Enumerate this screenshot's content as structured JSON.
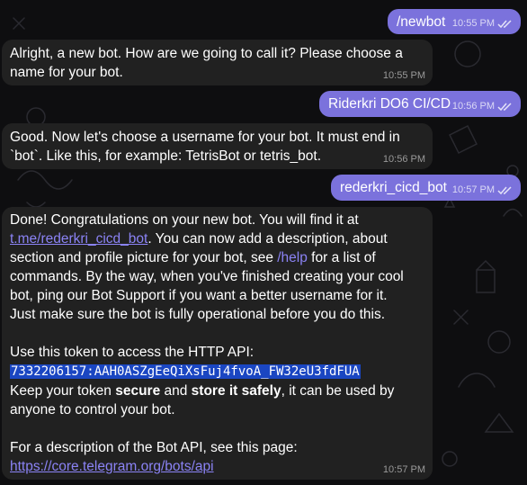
{
  "colors": {
    "outgoing": "#7b72dc",
    "incoming": "#212121",
    "link": "#8b83f5",
    "token_highlight": "#1a46c2",
    "background": "#0e0e10"
  },
  "messages": [
    {
      "direction": "out",
      "text": "/newbot",
      "time": "10:55 PM",
      "status": "read"
    },
    {
      "direction": "in",
      "lines": [
        "Alright, a new bot. How are we going to call it? Please choose a",
        "name for your bot."
      ],
      "time": "10:55 PM"
    },
    {
      "direction": "out",
      "text": "Riderkri DO6 CI/CD",
      "time": "10:56 PM",
      "status": "read"
    },
    {
      "direction": "in",
      "lines": [
        "Good. Now let's choose a username for your bot. It must end in",
        "`bot`. Like this, for example: TetrisBot or tetris_bot."
      ],
      "time": "10:56 PM"
    },
    {
      "direction": "out",
      "text": "rederkri_cicd_bot",
      "time": "10:57 PM",
      "status": "read"
    },
    {
      "direction": "in",
      "time": "10:57 PM",
      "p1_line1": "Done! Congratulations on your new bot. You will find it at",
      "bot_link": "t.me/rederkri_cicd_bot",
      "p1_line2_rest": ". You can now add a description, about",
      "p1_line3_pre": "section and profile picture for your bot, see ",
      "help_cmd": "/help",
      "p1_line3_post": " for a list of",
      "p1_line4": "commands. By the way, when you've finished creating your cool",
      "p1_line5": "bot, ping our Bot Support if you want a better username for it.",
      "p1_line6": "Just make sure the bot is fully operational before you do this.",
      "token_intro": "Use this token to access the HTTP API:",
      "token": "7332206157:AAH0ASZgEeQiXsFuj4fvoA_FW32eU3fdFUA",
      "keep_pre": "Keep your token ",
      "keep_bold1": "secure",
      "keep_mid": " and ",
      "keep_bold2": "store it safely",
      "keep_post": ", it can be used by",
      "keep_line2": "anyone to control your bot.",
      "api_intro": "For a description of the Bot API, see this page:",
      "api_link": "https://core.telegram.org/bots/api"
    }
  ]
}
